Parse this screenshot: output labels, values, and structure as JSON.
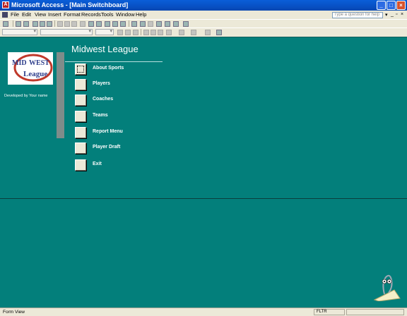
{
  "window": {
    "title": "Microsoft Access - [Main Switchboard]",
    "app_icon_glyph": "A"
  },
  "menubar": {
    "items": [
      "File",
      "Edit",
      "View",
      "Insert",
      "Format",
      "Records",
      "Tools",
      "Window",
      "Help"
    ],
    "question_placeholder": "Type a question for help"
  },
  "switchboard": {
    "title": "Midwest League",
    "developer_credit": "Developed by Your name",
    "logo": {
      "line1": "MID",
      "line2": "WEST",
      "line3": "League"
    },
    "items": [
      {
        "label": "About Sports"
      },
      {
        "label": "Players"
      },
      {
        "label": "Coaches"
      },
      {
        "label": "Teams"
      },
      {
        "label": "Report Menu"
      },
      {
        "label": "Player Draft"
      },
      {
        "label": "Exit"
      }
    ]
  },
  "statusbar": {
    "mode": "Form View",
    "indicator": "FLTR"
  },
  "colors": {
    "form_background": "#037F7B",
    "titlebar": "#0A5FD8"
  }
}
